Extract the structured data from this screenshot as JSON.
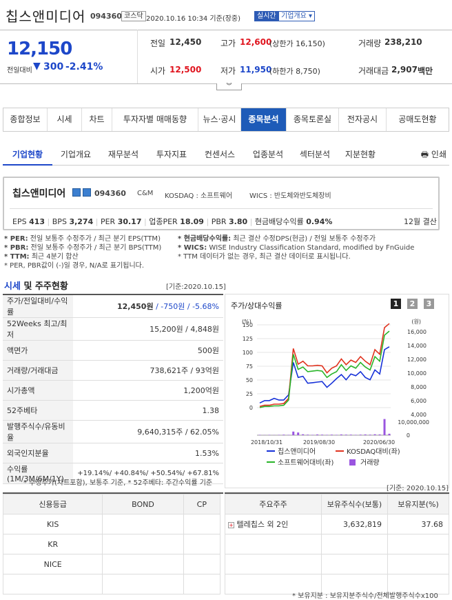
{
  "header": {
    "company": "칩스앤미디어",
    "code": "094360",
    "market": "코스닥",
    "datetime": "2020.10.16 10:34 기준(장중)",
    "realtime": "실시간",
    "company_overview": "기업개요 ▾"
  },
  "quote": {
    "price": "12,150",
    "change_label": "전일대비",
    "change_arrow": "▼",
    "change": "300",
    "change_pct": "-2.41%",
    "prev_label": "전일",
    "prev": "12,450",
    "high_label": "고가",
    "high": "12,600",
    "upper_limit": "(상한가 16,150)",
    "volume_label": "거래량",
    "volume": "238,210",
    "open_label": "시가",
    "open": "12,500",
    "low_label": "저가",
    "low": "11,950",
    "lower_limit": "(하한가 8,750)",
    "amount_label": "거래대금",
    "amount": "2,907",
    "amount_unit": "백만"
  },
  "tabs": [
    "종합정보",
    "시세",
    "차트",
    "투자자별 매매동향",
    "뉴스·공시",
    "종목분석",
    "종목토론실",
    "전자공시",
    "공매도현황"
  ],
  "subtabs": [
    "기업현황",
    "기업개요",
    "재무분석",
    "투자지표",
    "컨센서스",
    "업종분석",
    "섹터분석",
    "지분현황"
  ],
  "print": "인쇄",
  "info": {
    "name": "칩스앤미디어",
    "code": "094360",
    "cm": "C&M",
    "kosdaq": "KOSDAQ : 소프트웨어",
    "wics": "WICS : 반도체와반도체장비",
    "eps_l": "EPS",
    "eps": "413",
    "bps_l": "BPS",
    "bps": "3,274",
    "per_l": "PER",
    "per": "30.17",
    "iper_l": "업종PER",
    "iper": "18.09",
    "pbr_l": "PBR",
    "pbr": "3.80",
    "div_l": "현금배당수익률",
    "div": "0.94%",
    "settle": "12월 결산"
  },
  "notes": {
    "l1a": "* PER:",
    "l1b": " 전일 보통주 수정주가 / 최근 분기 EPS(TTM)",
    "l2a": "* PBR:",
    "l2b": " 전일 보통주 수정주가 / 최근 분기 BPS(TTM)",
    "l3a": "* TTM:",
    "l3b": " 최근 4분기 합산",
    "l4": "* PER, PBR값이 (-)일 경우, N/A로 표기됩니다.",
    "r1a": "* 현금배당수익률:",
    "r1b": " 최근 결산 수정DPS(현금) / 전일 보통주 수정주가",
    "r2a": "* WICS:",
    "r2b": " WISE Industry Classification Standard, modified by FnGuide",
    "r3": "* TTM 데이터가 없는 경우, 최근 결산 데이터로 표시됩니다."
  },
  "section": {
    "title_a": "시세",
    "title_b": " 및 주주현황",
    "base": "[기준:2020.10.15]"
  },
  "price_table": [
    {
      "label": "주가/전일대비/수익률",
      "v1": "12,450원",
      "v2": " / -750원",
      "v3": " / -5.68%"
    },
    {
      "label": "52Weeks 최고/최저",
      "v": "15,200원 / 4,848원"
    },
    {
      "label": "액면가",
      "v": "500원"
    },
    {
      "label": "거래량/거래대금",
      "v": "738,621주 / 93억원"
    },
    {
      "label": "시가총액",
      "v": "1,200억원"
    },
    {
      "label": "52주베타",
      "v": "1.38"
    },
    {
      "label": "발행주식수/유동비율",
      "v": "9,640,315주 / 62.05%"
    },
    {
      "label": "외국인지분율",
      "v": "1.53%"
    }
  ],
  "returns": {
    "label": "수익률 (1M/3M/6M/1Y)",
    "r1": "+19.14%",
    "r2": "+40.84%",
    "r3": "+50.54%",
    "r4": "+67.81%"
  },
  "left_foot": "* 수정주가(차트포함), 보통주 기준, * 52주베타: 주간수익률 기준",
  "chart_title": "주가/상대수익률",
  "chart_buttons": [
    "1",
    "2",
    "3"
  ],
  "chart_data": {
    "type": "line",
    "y_left_unit": "(%)",
    "y_right_unit": "(원)",
    "y_left_ticks": [
      "150",
      "125",
      "100",
      "75",
      "50",
      "25",
      "0"
    ],
    "y_right_ticks": [
      "16,000",
      "14,000",
      "12,000",
      "10,000",
      "8,000",
      "6,000",
      "4,000"
    ],
    "volume_ticks": [
      "10,000,000",
      "0"
    ],
    "x_ticks": [
      "2018/10/31",
      "2019/08/30",
      "2020/06/30"
    ],
    "series": [
      {
        "name": "칩스앤미디어",
        "color": "#1530d8",
        "values": [
          8,
          12,
          12,
          16,
          13,
          13,
          22,
          78,
          52,
          54,
          42,
          43,
          44,
          45,
          35,
          42,
          50,
          57,
          48,
          58,
          55,
          62,
          52,
          48,
          65,
          58,
          100,
          105
        ]
      },
      {
        "name": "KOSDAQ대비(좌)",
        "color": "#e0321e",
        "values": [
          2,
          4,
          4,
          6,
          6,
          7,
          16,
          102,
          75,
          80,
          72,
          72,
          73,
          72,
          60,
          68,
          72,
          84,
          74,
          82,
          78,
          88,
          80,
          74,
          100,
          92,
          138,
          145
        ]
      },
      {
        "name": "소프트웨어대비(좌)",
        "color": "#28b428",
        "values": [
          0,
          2,
          2,
          3,
          3,
          4,
          13,
          92,
          66,
          70,
          62,
          63,
          64,
          63,
          52,
          58,
          62,
          74,
          64,
          72,
          68,
          78,
          70,
          65,
          88,
          80,
          125,
          132
        ]
      }
    ],
    "volume": [
      0.02,
      0.01,
      0.02,
      0.01,
      0.02,
      0.03,
      0.02,
      0.2,
      0.15,
      0.05,
      0.03,
      0.02,
      0.04,
      0.03,
      0.02,
      0.03,
      0.02,
      0.04,
      0.03,
      0.03,
      0.02,
      0.03,
      0.04,
      0.03,
      0.05,
      0.04,
      0.9,
      0.08
    ],
    "legend": [
      "칩스앤미디어",
      "KOSDAQ대비(좌)",
      "소프트웨어대비(좌)",
      "거래량"
    ],
    "legend_colors": [
      "#1530d8",
      "#e0321e",
      "#28b428",
      "#9a55e0"
    ]
  },
  "bottom_base": "[기준: 2020.10.15]",
  "credit": {
    "headers": [
      "신용등급",
      "BOND",
      "CP"
    ],
    "rows": [
      [
        "KIS",
        "",
        ""
      ],
      [
        "KR",
        "",
        ""
      ],
      [
        "NICE",
        "",
        ""
      ],
      [
        "",
        "",
        ""
      ]
    ]
  },
  "holders": {
    "headers": [
      "주요주주",
      "보유주식수(보통)",
      "보유지분(%)"
    ],
    "rows": [
      [
        "텔레칩스 외 2인",
        "3,632,819",
        "37.68"
      ],
      [
        "",
        "",
        ""
      ],
      [
        "",
        "",
        ""
      ],
      [
        "",
        "",
        ""
      ]
    ]
  },
  "bottom_note": "* 보유지분 : 보유지분주식수/전체발행주식수x100"
}
